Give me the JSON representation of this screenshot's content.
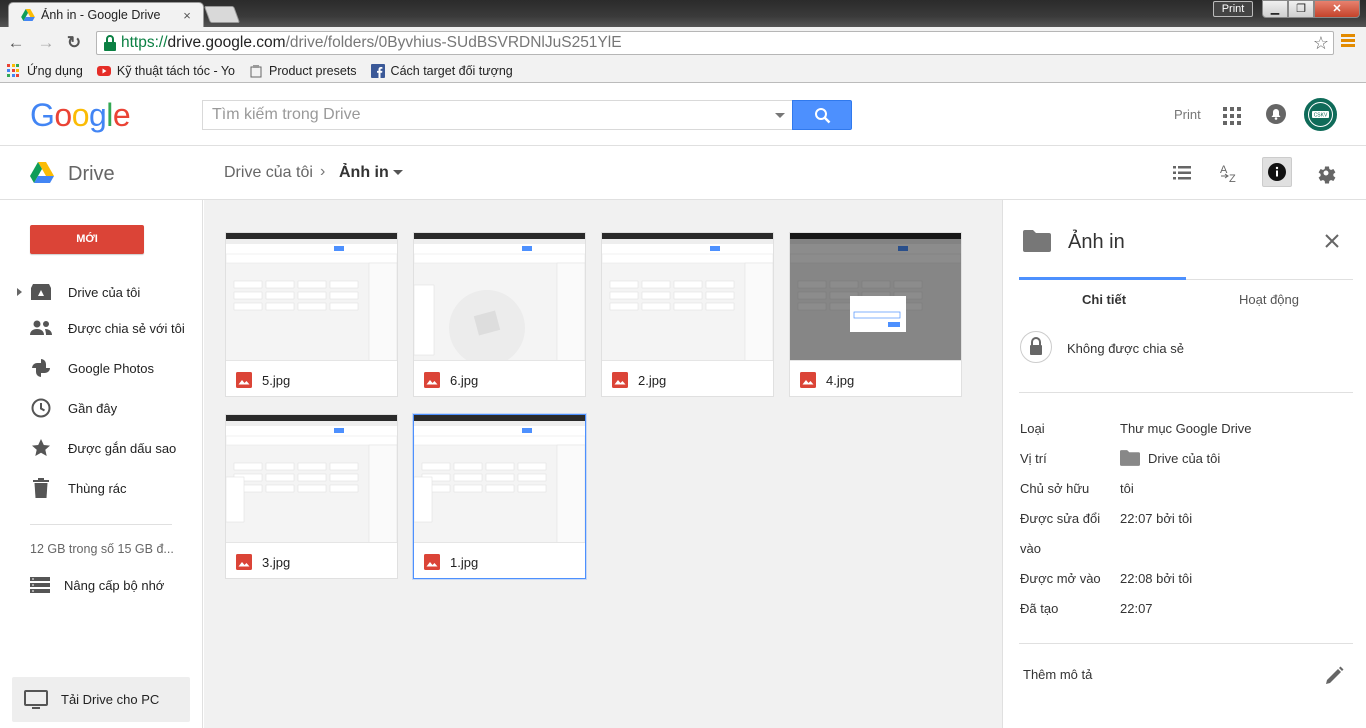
{
  "browser": {
    "tab_title": "Ảnh in - Google Drive",
    "tab_close": "×",
    "print_button": "Print",
    "min_btn": "▁",
    "max_btn": "❐",
    "close_btn": "✕",
    "url_scheme": "https://",
    "url_host": "drive.google.com",
    "url_path": "/drive/folders/0Byvhius-SUdBSVRDNlJuS251YlE",
    "back": "←",
    "forward": "→",
    "reload": "↻",
    "star": "☆",
    "bookmarks": [
      {
        "label": "Ứng dụng",
        "icon": "apps-icon"
      },
      {
        "label": "Kỹ thuật tách tóc - Yo",
        "icon": "youtube-icon"
      },
      {
        "label": "Product presets",
        "icon": "page-icon"
      },
      {
        "label": "Cách target đối tượng",
        "icon": "facebook-icon"
      }
    ]
  },
  "header": {
    "logo": {
      "letters": [
        "G",
        "o",
        "o",
        "g",
        "l",
        "e"
      ],
      "colors": [
        "#4285f4",
        "#ea4335",
        "#fbbc05",
        "#4285f4",
        "#34a853",
        "#ea4335"
      ]
    },
    "search_placeholder": "Tìm kiếm trong Drive",
    "print_link": "Print",
    "avatar_text": "CSKV"
  },
  "drive_bar": {
    "app_name": "Drive",
    "breadcrumb_root": "Drive của tôi",
    "breadcrumb_sep": "›",
    "breadcrumb_current": "Ảnh in"
  },
  "sidebar": {
    "new_button": "MỚI",
    "items": [
      {
        "label": "Drive của tôi",
        "icon": "my-drive-icon"
      },
      {
        "label": "Được chia sẻ với tôi",
        "icon": "shared-icon"
      },
      {
        "label": "Google Photos",
        "icon": "photos-icon"
      },
      {
        "label": "Gần đây",
        "icon": "recent-icon"
      },
      {
        "label": "Được gắn dấu sao",
        "icon": "starred-icon"
      },
      {
        "label": "Thùng rác",
        "icon": "trash-icon"
      }
    ],
    "storage": "12 GB trong số 15 GB đ...",
    "upgrade": "Nâng cấp bộ nhớ",
    "download_pc": "Tải Drive cho PC"
  },
  "files": [
    {
      "name": "5.jpg",
      "selected": false
    },
    {
      "name": "6.jpg",
      "selected": false
    },
    {
      "name": "2.jpg",
      "selected": false
    },
    {
      "name": "4.jpg",
      "selected": false
    },
    {
      "name": "3.jpg",
      "selected": false
    },
    {
      "name": "1.jpg",
      "selected": true
    }
  ],
  "details": {
    "title": "Ảnh in",
    "tab_details": "Chi tiết",
    "tab_activity": "Hoạt động",
    "sharing": "Không được chia sẻ",
    "props": [
      {
        "label": "Loại",
        "value": "Thư mục Google Drive"
      },
      {
        "label": "Vị trí",
        "value": "Drive của tôi"
      },
      {
        "label": "Chủ sở hữu",
        "value": "tôi"
      },
      {
        "label": "Được sửa đổi",
        "value": "22:07 bởi tôi"
      },
      {
        "label": "vào",
        "value": ""
      },
      {
        "label": "Được mở vào",
        "value": "22:08 bởi tôi"
      },
      {
        "label": "Đã tạo",
        "value": "22:07"
      }
    ],
    "add_description": "Thêm mô tả"
  },
  "colors": {
    "accent_blue": "#4d90fe",
    "new_red": "#db4437",
    "image_icon_red": "#db4437"
  }
}
